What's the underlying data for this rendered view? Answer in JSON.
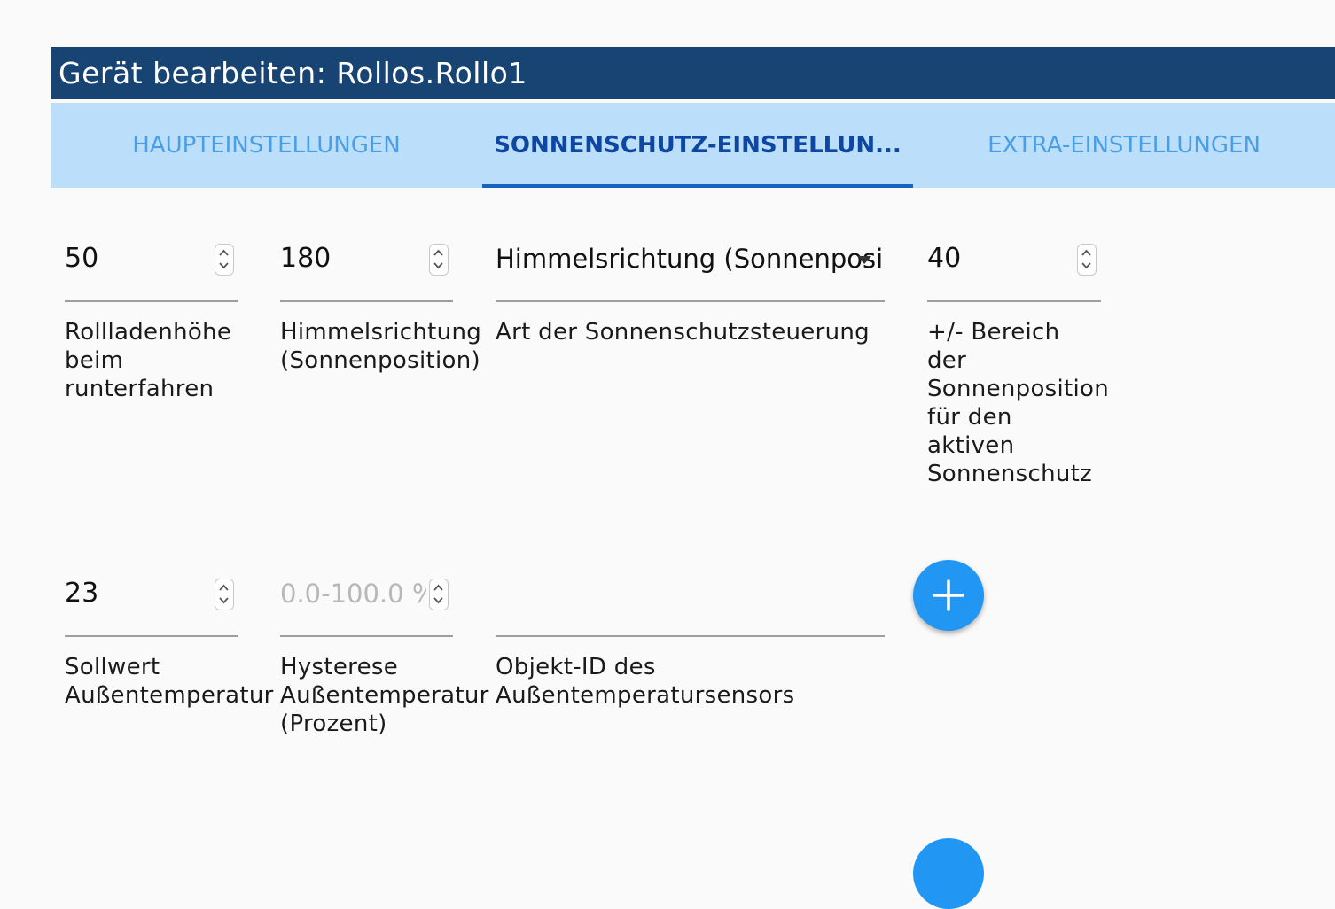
{
  "dialog": {
    "title": "Gerät bearbeiten: Rollos.Rollo1"
  },
  "tabs": [
    {
      "label": "HAUPTEINSTELLUNGEN",
      "active": false
    },
    {
      "label": "SONNENSCHUTZ-EINSTELLUN...",
      "active": true
    },
    {
      "label": "EXTRA-EINSTELLUNGEN",
      "active": false
    }
  ],
  "fields": {
    "rollladen_hoehe": {
      "value": "50",
      "label": "Rollladenhöhe beim runterfahren"
    },
    "himmelsrichtung": {
      "value": "180",
      "label": "Himmelsrichtung (Sonnenposition)"
    },
    "art_sonnenschutz": {
      "value": "Himmelsrichtung (Sonnenposition)",
      "label": "Art der Sonnenschutzsteuerung"
    },
    "bereich_sonnenposition": {
      "value": "40",
      "label": "+/- Bereich der Sonnenposition für den aktiven Sonnenschutz"
    },
    "sollwert_aussentemp": {
      "value": "23",
      "label": "Sollwert Außentemperatur"
    },
    "hysterese_aussentemp": {
      "placeholder": "0.0-100.0 %",
      "label": "Hysterese Außentemperatur (Prozent)"
    },
    "objekt_id_sensor": {
      "value": "",
      "label": "Objekt-ID des Außentemperatursensors"
    }
  },
  "colors": {
    "title_bar": "#184474",
    "tab_bar": "#bbdefb",
    "tab_active": "#0d47a1",
    "tab_inactive": "#4a9ee6",
    "fab": "#2196f3"
  },
  "icons": {
    "fab": "plus-icon",
    "spinner": "stepper-arrows-icon",
    "select": "dropdown-arrow-icon"
  }
}
